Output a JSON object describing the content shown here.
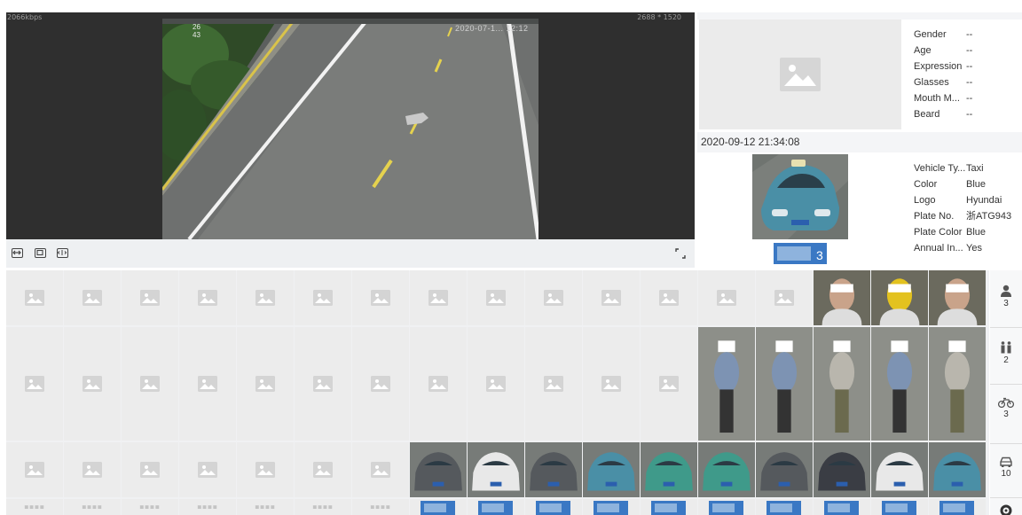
{
  "video": {
    "bitrate": "2066kbps",
    "resolution": "2688 * 1520",
    "camera_timestamp": "2020-07-1... 12:12",
    "camera_digits": "26\n43"
  },
  "toolbar": {
    "icons": [
      "fit-window-icon",
      "original-size-icon",
      "stretch-icon",
      "fullscreen-icon"
    ]
  },
  "face": {
    "attributes": [
      {
        "key": "Gender",
        "value": "--"
      },
      {
        "key": "Age",
        "value": "--"
      },
      {
        "key": "Expression",
        "value": "--"
      },
      {
        "key": "Glasses",
        "value": "--"
      },
      {
        "key": "Mouth M...",
        "value": "--"
      },
      {
        "key": "Beard",
        "value": "--"
      }
    ]
  },
  "event": {
    "time": "2020-09-12 21:34:08"
  },
  "vehicle": {
    "attributes": [
      {
        "key": "Vehicle Ty...",
        "value": "Taxi"
      },
      {
        "key": "Color",
        "value": "Blue"
      },
      {
        "key": "Logo",
        "value": "Hyundai"
      },
      {
        "key": "Plate No.",
        "value": "浙ATG943"
      },
      {
        "key": "Plate Color",
        "value": "Blue"
      },
      {
        "key": "Annual In...",
        "value": "Yes"
      }
    ]
  },
  "categories": [
    {
      "name": "face",
      "icon": "person-icon",
      "count": "3"
    },
    {
      "name": "human-body",
      "icon": "people-icon",
      "count": "2"
    },
    {
      "name": "non-motor-vehicle",
      "icon": "bicycle-icon",
      "count": "3"
    },
    {
      "name": "motor-vehicle",
      "icon": "car-icon",
      "count": "10"
    },
    {
      "name": "settings",
      "icon": "settings-icon",
      "count": ""
    }
  ],
  "grid": {
    "plate_placeholder": "■■■■"
  },
  "colors": {
    "video_bg": "#2f2f2f",
    "panel_bg": "#ebebeb",
    "placeholder_icon": "#ffffff"
  }
}
